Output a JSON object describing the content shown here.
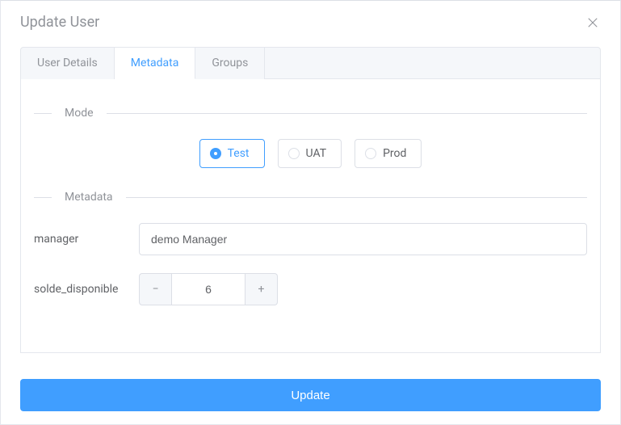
{
  "dialog": {
    "title": "Update User"
  },
  "tabs": {
    "items": [
      {
        "label": "User Details"
      },
      {
        "label": "Metadata"
      },
      {
        "label": "Groups"
      }
    ],
    "active_index": 1
  },
  "sections": {
    "mode": {
      "label": "Mode"
    },
    "metadata": {
      "label": "Metadata"
    }
  },
  "mode_options": {
    "items": [
      {
        "label": "Test",
        "value": "test"
      },
      {
        "label": "UAT",
        "value": "uat"
      },
      {
        "label": "Prod",
        "value": "prod"
      }
    ],
    "selected": "test"
  },
  "form": {
    "manager": {
      "label": "manager",
      "value": "demo Manager"
    },
    "solde_disponible": {
      "label": "solde_disponible",
      "value": "6"
    }
  },
  "footer": {
    "submit_label": "Update"
  },
  "icons": {
    "minus": "−",
    "plus": "+"
  }
}
